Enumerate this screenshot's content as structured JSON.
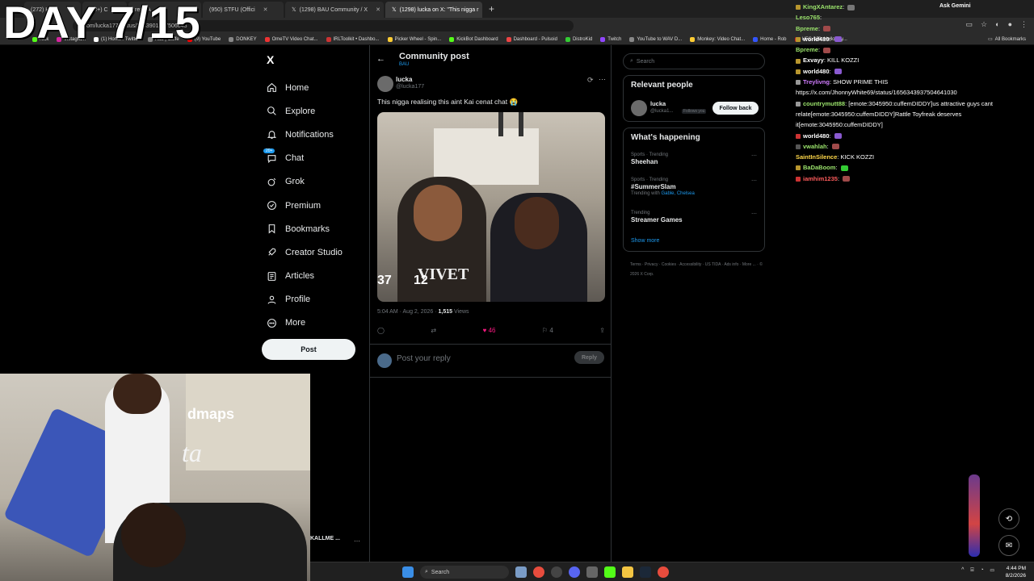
{
  "overlay": {
    "day": "DAY 7/15"
  },
  "browser": {
    "tabs": [
      {
        "label": "(272) Hom"
      },
      {
        "label": "(99+) C"
      },
      {
        "label": "reak A"
      },
      {
        "label": "(950) STFU (Offici"
      },
      {
        "label": "(1298) BAU Community / X"
      },
      {
        "label": "(1298) lucka on X: \"This nigga r"
      }
    ],
    "url": "x.com/lucka177/status/2083901777506843",
    "ask_gemini": "Ask Gemini",
    "bookmarks": [
      "Kick",
      "Instagram",
      "(1) Home / Twitter",
      "Rau | Cuffe",
      "(9) YouTube",
      "DONKEY",
      "OmeTV Video Chat...",
      "IRLToolkit • Dashbo...",
      "Picker Wheel - Spin...",
      "KickBot Dashboard",
      "Dashboard - Pulsoid",
      "DistroKid",
      "Twitch",
      "YouTube to WAV D...",
      "Monkey: Video Chat...",
      "Home - Rob",
      "UFC 326: Holloway..."
    ],
    "all_bookmarks": "All Bookmarks"
  },
  "nav": {
    "logo": "X",
    "items": [
      {
        "label": "Home",
        "icon": "home-icon"
      },
      {
        "label": "Explore",
        "icon": "search-icon"
      },
      {
        "label": "Notifications",
        "icon": "bell-icon"
      },
      {
        "label": "Chat",
        "icon": "chat-icon",
        "badge": "20+"
      },
      {
        "label": "Grok",
        "icon": "grok-icon"
      },
      {
        "label": "Premium",
        "icon": "premium-icon"
      },
      {
        "label": "Bookmarks",
        "icon": "bookmark-icon"
      },
      {
        "label": "Creator Studio",
        "icon": "rocket-icon"
      },
      {
        "label": "Articles",
        "icon": "articles-icon"
      },
      {
        "label": "Profile",
        "icon": "profile-icon"
      },
      {
        "label": "More",
        "icon": "more-icon"
      }
    ],
    "post_label": "Post"
  },
  "post": {
    "header_title": "Community post",
    "header_sub": "BAU",
    "author": "lucka",
    "handle": "@lucka177",
    "text": "This nigga realising this aint Kai cenat chat 😭",
    "media_overlay": {
      "left": "37",
      "right": "12",
      "shirt": "VIVET"
    },
    "time": "5:04 AM · Aug 2, 2026 · ",
    "views_count": "1,515",
    "views_label": " Views",
    "likes": "46",
    "bookmarks": "4",
    "reply_placeholder": "Post your reply",
    "reply_button": "Reply"
  },
  "sidebar": {
    "search_placeholder": "Search",
    "relevant_title": "Relevant people",
    "person_name": "lucka",
    "person_handle": "@lucka1...",
    "follows_you": "Follows you",
    "follow_back": "Follow back",
    "happening_title": "What's happening",
    "trends": [
      {
        "category": "Sports · Trending",
        "name": "Sheehan",
        "with": "",
        "with_links": ""
      },
      {
        "category": "Sports · Trending",
        "name": "#SummerSlam",
        "with": "Trending with ",
        "with_links": "Gable, Chelsea"
      },
      {
        "category": "Trending",
        "name": "Streamer Games",
        "with": "",
        "with_links": ""
      }
    ],
    "show_more": "Show more",
    "footer": "Terms · Privacy · Cookies · Accessibility · US TIDA · Ads info · More ... · © 2026 X Corp."
  },
  "chat": [
    {
      "user": "KingXAntarez",
      "color": "#9be36c",
      "text": ""
    },
    {
      "user": "Leso765",
      "color": "#9be36c",
      "text": ""
    },
    {
      "user": "Bpreme",
      "color": "#9be36c",
      "text": ""
    },
    {
      "user": "world480",
      "color": "#ffffff",
      "text": ""
    },
    {
      "user": "Bpreme",
      "color": "#9be36c",
      "text": ""
    },
    {
      "user": "Exvayy",
      "color": "#ffffff",
      "text": "KILL KOZZI"
    },
    {
      "user": "world480",
      "color": "#ffffff",
      "text": ""
    },
    {
      "user": "Treylivng",
      "color": "#d07cff",
      "text": "SHOW PRIME THIS https://x.com/JhonnyWhite69/status/1656343937504641030"
    },
    {
      "user": "countrymutt88",
      "color": "#9be36c",
      "text": "[emote:3045950:cuffemDIDDY]us attractive guys cant relate[emote:3045950:cuffemDIDDY]Rattle Toyfreak deserves it[emote:3045950:cuffemDIDDY]"
    },
    {
      "user": "world480",
      "color": "#ffffff",
      "text": ""
    },
    {
      "user": "vwahlah",
      "color": "#9be36c",
      "text": ""
    },
    {
      "user": "SaintInSilence",
      "color": "#ffd84a",
      "text": "KICK KOZZI"
    },
    {
      "user": "BaDaBoom",
      "color": "#9be36c",
      "text": ""
    },
    {
      "user": "iamhim1235",
      "color": "#ff5c5c",
      "text": ""
    }
  ],
  "webcam": {
    "sign_top": "dmaps",
    "sign_bottom": "ta",
    "username": "KALLME ..."
  },
  "taskbar": {
    "search": "Search",
    "time": "4:44 PM",
    "date": "8/2/2026"
  }
}
